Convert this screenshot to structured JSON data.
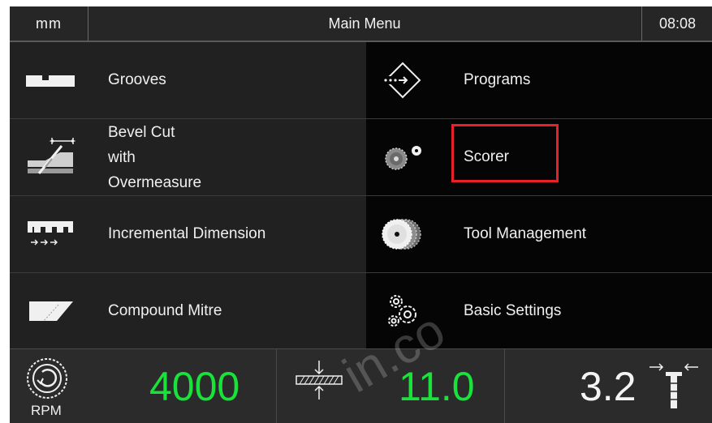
{
  "header": {
    "unit": "mm",
    "title": "Main Menu",
    "time": "08:08"
  },
  "menu": {
    "grooves": {
      "label": "Grooves",
      "icon": "grooves-icon"
    },
    "bevel": {
      "line1": "Bevel Cut",
      "line2": "with",
      "line3": "Overmeasure",
      "icon": "bevel-cut-icon"
    },
    "incremental": {
      "label": "Incremental Dimension",
      "icon": "incremental-dimension-icon"
    },
    "compound": {
      "label": "Compound Mitre",
      "icon": "compound-mitre-icon"
    },
    "programs": {
      "label": "Programs",
      "icon": "programs-icon"
    },
    "scorer": {
      "label": "Scorer",
      "icon": "scorer-icon"
    },
    "tools": {
      "label": "Tool Management",
      "icon": "tool-management-icon"
    },
    "settings": {
      "label": "Basic Settings",
      "icon": "basic-settings-icon"
    }
  },
  "status": {
    "rpm_label": "RPM",
    "rpm_value": "4000",
    "thickness_value": "11.0",
    "width_value": "3.2"
  },
  "watermark": "in.co",
  "colors": {
    "accent_green": "#19e23a",
    "highlight_red": "#e8202a"
  }
}
